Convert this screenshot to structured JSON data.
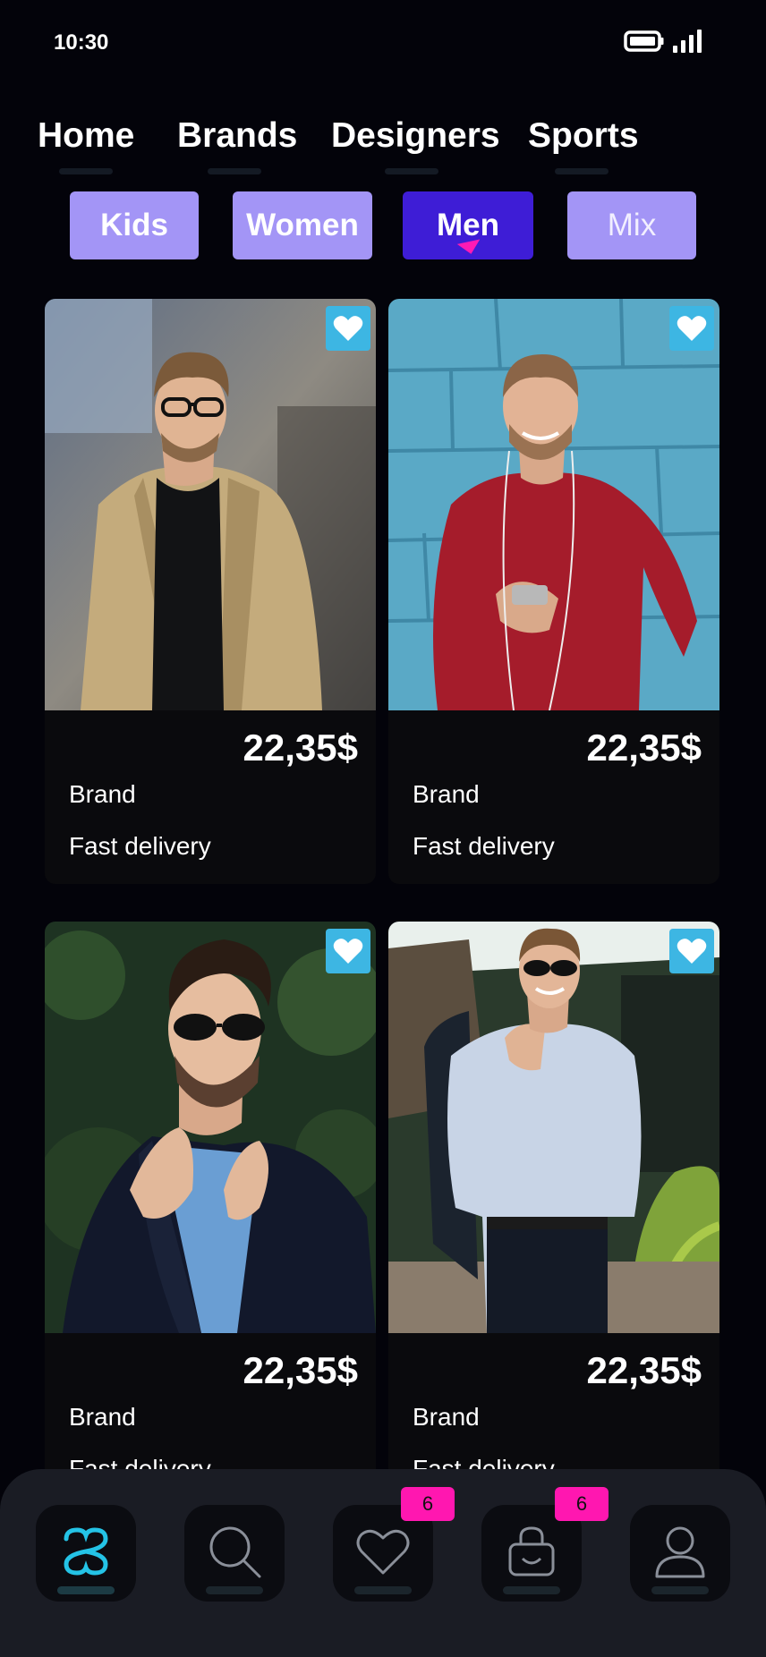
{
  "status_bar": {
    "time": "10:30",
    "battery_icon": "battery-icon",
    "signal_icon": "signal-icon"
  },
  "top_tabs": [
    {
      "label": "Home"
    },
    {
      "label": "Brands"
    },
    {
      "label": "Designers"
    },
    {
      "label": "Sports"
    }
  ],
  "categories": [
    {
      "label": "Kids",
      "active": false
    },
    {
      "label": "Women",
      "active": false
    },
    {
      "label": "Men",
      "active": true
    },
    {
      "label": "Mix",
      "active": false
    }
  ],
  "products": [
    {
      "price": "22,35$",
      "brand": "Brand",
      "delivery": "Fast delivery",
      "favorited": true,
      "photo": "man-in-beige-coat"
    },
    {
      "price": "22,35$",
      "brand": "Brand",
      "delivery": "Fast delivery",
      "favorited": true,
      "photo": "man-in-red-sweater"
    },
    {
      "price": "22,35$",
      "brand": "Brand",
      "delivery": "Fast delivery",
      "favorited": true,
      "photo": "man-in-navy-blazer"
    },
    {
      "price": "22,35$",
      "brand": "Brand",
      "delivery": "Fast delivery",
      "favorited": true,
      "photo": "man-in-light-shirt"
    }
  ],
  "bottom_nav": {
    "items": [
      {
        "icon": "logo-icon",
        "active": true
      },
      {
        "icon": "search-icon",
        "active": false
      },
      {
        "icon": "heart-icon",
        "active": false,
        "badge": "6"
      },
      {
        "icon": "shopping-bag-icon",
        "active": false,
        "badge": "6"
      },
      {
        "icon": "profile-icon",
        "active": false
      }
    ]
  },
  "colors": {
    "background": "#03030a",
    "chip": "#a395f6",
    "chip_active": "#3e1dd6",
    "accent_cyan": "#3db6e3",
    "badge": "#ff17b0",
    "nav_bar": "#1a1c24"
  }
}
